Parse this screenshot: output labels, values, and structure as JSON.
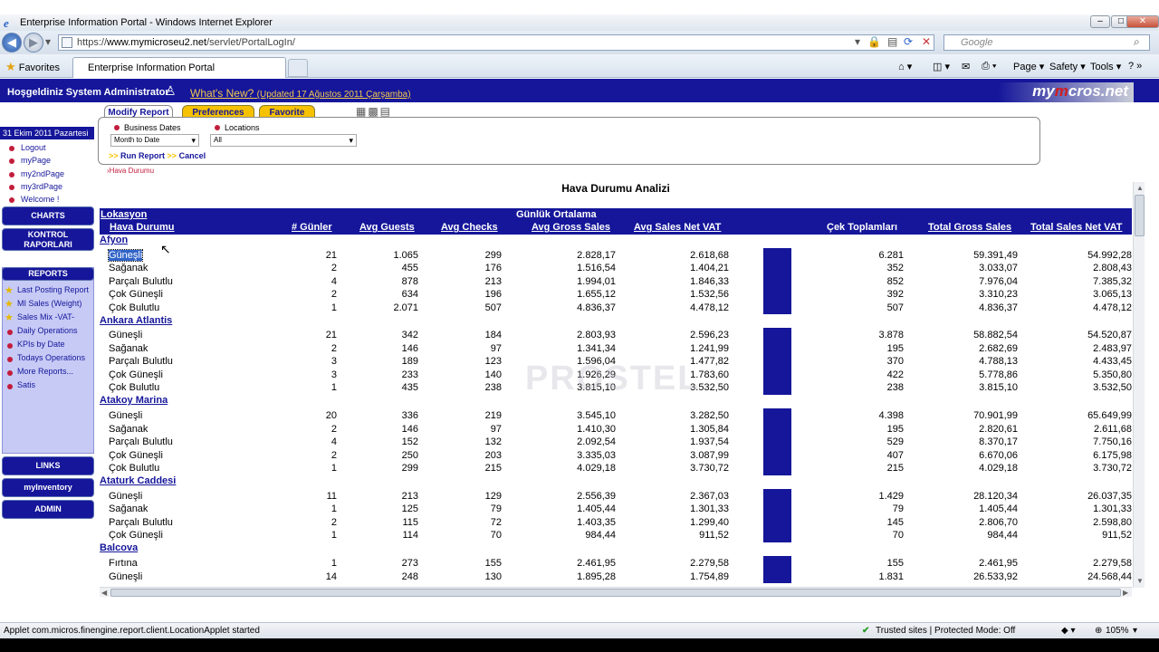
{
  "window": {
    "title": "Enterprise Information Portal - Windows Internet Explorer",
    "url_prefix": "https://",
    "url_host": "www.mymicroseu2.net",
    "url_path": "/servlet/PortalLogIn/",
    "search_placeholder": "Google",
    "favorites_label": "Favorites",
    "tab_title": "Enterprise Information Portal",
    "cmd_page": "Page ▾",
    "cmd_safety": "Safety ▾",
    "cmd_tools": "Tools ▾"
  },
  "banner": {
    "welcome": "Hoşgeldiniz System Administrator",
    "whats_new": "What's New?",
    "whats_new_updated": "(Updated 17 Ağustos 2011 Çarşamba)",
    "logo_a": "my",
    "logo_b": "m",
    "logo_c": "cros.net"
  },
  "sidebar": {
    "date": "31 Ekim 2011 Pazartesi",
    "links": [
      "Logout",
      "myPage",
      "my2ndPage",
      "my3rdPage",
      "Welcome !"
    ],
    "charts": "CHARTS",
    "kontrol": "KONTROL RAPORLARI",
    "reports": "REPORTS",
    "report_items": [
      {
        "label": "Last Posting Report",
        "starred": true
      },
      {
        "label": "MI Sales (Weight)",
        "starred": true
      },
      {
        "label": "Sales Mix -VAT-",
        "starred": true
      },
      {
        "label": "Daily Operations",
        "starred": false
      },
      {
        "label": "KPIs by Date",
        "starred": false
      },
      {
        "label": "Todays Operations",
        "starred": false
      },
      {
        "label": "More Reports...",
        "starred": false
      },
      {
        "label": "Satis",
        "starred": false
      }
    ],
    "links_btn": "LINKS",
    "myinventory": "myInventory",
    "admin": "ADMIN"
  },
  "controls": {
    "tab_modify": "Modify Report",
    "tab_preferences": "Preferences",
    "tab_favorite": "Favorite",
    "business_dates_label": "Business Dates",
    "business_dates_value": "Month to Date",
    "locations_label": "Locations",
    "locations_value": "All",
    "run_report": "Run Report",
    "cancel": "Cancel",
    "breadcrumb": "Hava Durumu"
  },
  "report": {
    "title": "Hava Durumu Analizi",
    "header": {
      "lokasyon": "Lokasyon",
      "gunluk": "Günlük Ortalama",
      "hava": "Hava Durumu",
      "gunler": "# Günler",
      "avg_guests": "Avg Guests",
      "avg_checks": "Avg Checks",
      "avg_gross": "Avg Gross Sales",
      "avg_net": "Avg Sales Net VAT",
      "cek": "Çek Toplamları",
      "total_gross": "Total Gross Sales",
      "total_net": "Total Sales Net VAT"
    },
    "watermark": "PROSTEL",
    "groups": [
      {
        "location": "Afyon",
        "rows": [
          [
            "Güneşli",
            "21",
            "1.065",
            "299",
            "2.828,17",
            "2.618,68",
            "6.281",
            "59.391,49",
            "54.992,28"
          ],
          [
            "Sağanak",
            "2",
            "455",
            "176",
            "1.516,54",
            "1.404,21",
            "352",
            "3.033,07",
            "2.808,43"
          ],
          [
            "Parçalı Bulutlu",
            "4",
            "878",
            "213",
            "1.994,01",
            "1.846,33",
            "852",
            "7.976,04",
            "7.385,32"
          ],
          [
            "Çok Güneşli",
            "2",
            "634",
            "196",
            "1.655,12",
            "1.532,56",
            "392",
            "3.310,23",
            "3.065,13"
          ],
          [
            "Çok Bulutlu",
            "1",
            "2.071",
            "507",
            "4.836,37",
            "4.478,12",
            "507",
            "4.836,37",
            "4.478,12"
          ]
        ]
      },
      {
        "location": "Ankara Atlantis",
        "rows": [
          [
            "Güneşli",
            "21",
            "342",
            "184",
            "2.803,93",
            "2.596,23",
            "3.878",
            "58.882,54",
            "54.520,87"
          ],
          [
            "Sağanak",
            "2",
            "146",
            "97",
            "1.341,34",
            "1.241,99",
            "195",
            "2.682,69",
            "2.483,97"
          ],
          [
            "Parçalı Bulutlu",
            "3",
            "189",
            "123",
            "1.596,04",
            "1.477,82",
            "370",
            "4.788,13",
            "4.433,45"
          ],
          [
            "Çok Güneşli",
            "3",
            "233",
            "140",
            "1.926,29",
            "1.783,60",
            "422",
            "5.778,86",
            "5.350,80"
          ],
          [
            "Çok Bulutlu",
            "1",
            "435",
            "238",
            "3.815,10",
            "3.532,50",
            "238",
            "3.815,10",
            "3.532,50"
          ]
        ]
      },
      {
        "location": "Atakoy Marina",
        "rows": [
          [
            "Güneşli",
            "20",
            "336",
            "219",
            "3.545,10",
            "3.282,50",
            "4.398",
            "70.901,99",
            "65.649,99"
          ],
          [
            "Sağanak",
            "2",
            "146",
            "97",
            "1.410,30",
            "1.305,84",
            "195",
            "2.820,61",
            "2.611,68"
          ],
          [
            "Parçalı Bulutlu",
            "4",
            "152",
            "132",
            "2.092,54",
            "1.937,54",
            "529",
            "8.370,17",
            "7.750,16"
          ],
          [
            "Çok Güneşli",
            "2",
            "250",
            "203",
            "3.335,03",
            "3.087,99",
            "407",
            "6.670,06",
            "6.175,98"
          ],
          [
            "Çok Bulutlu",
            "1",
            "299",
            "215",
            "4.029,18",
            "3.730,72",
            "215",
            "4.029,18",
            "3.730,72"
          ]
        ]
      },
      {
        "location": "Ataturk Caddesi",
        "rows": [
          [
            "Güneşli",
            "11",
            "213",
            "129",
            "2.556,39",
            "2.367,03",
            "1.429",
            "28.120,34",
            "26.037,35"
          ],
          [
            "Sağanak",
            "1",
            "125",
            "79",
            "1.405,44",
            "1.301,33",
            "79",
            "1.405,44",
            "1.301,33"
          ],
          [
            "Parçalı Bulutlu",
            "2",
            "115",
            "72",
            "1.403,35",
            "1.299,40",
            "145",
            "2.806,70",
            "2.598,80"
          ],
          [
            "Çok Güneşli",
            "1",
            "114",
            "70",
            "984,44",
            "911,52",
            "70",
            "984,44",
            "911,52"
          ]
        ]
      },
      {
        "location": "Balcova",
        "rows": [
          [
            "Fırtına",
            "1",
            "273",
            "155",
            "2.461,95",
            "2.279,58",
            "155",
            "2.461,95",
            "2.279,58"
          ],
          [
            "Güneşli",
            "14",
            "248",
            "130",
            "1.895,28",
            "1.754,89",
            "1.831",
            "26.533,92",
            "24.568,44"
          ]
        ]
      }
    ]
  },
  "status": {
    "left": "Applet com.micros.finengine.report.client.LocationApplet started",
    "trusted": "Trusted sites | Protected Mode: Off",
    "zoom": "105%"
  }
}
